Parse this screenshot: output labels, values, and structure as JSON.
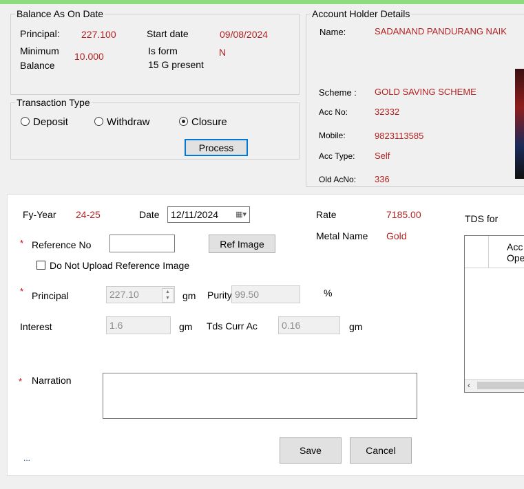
{
  "balance": {
    "legend": "Balance As On Date",
    "principal_label": "Principal:",
    "principal_value": "227.100",
    "start_date_label": "Start date",
    "start_date_value": "09/08/2024",
    "min_balance_label_1": "Minimum",
    "min_balance_label_2": "Balance",
    "min_balance_value": "10.000",
    "form15g_label_1": "Is form",
    "form15g_label_2": "15 G present",
    "form15g_value": "N"
  },
  "account_holder": {
    "legend": "Account Holder Details",
    "name_label": "Name:",
    "name_value": "SADANAND PANDURANG NAIK",
    "scheme_label": "Scheme :",
    "scheme_value": "GOLD SAVING SCHEME",
    "accno_label": "Acc No:",
    "accno_value": "32332",
    "mobile_label": "Mobile:",
    "mobile_value": "9823113585",
    "acctype_label": "Acc Type:",
    "acctype_value": "Self",
    "oldacno_label": "Old AcNo:",
    "oldacno_value": "336"
  },
  "transaction_type": {
    "legend": "Transaction Type",
    "options": [
      "Deposit",
      "Withdraw",
      "Closure"
    ],
    "selected": "Closure",
    "process_label": "Process"
  },
  "form": {
    "fy_label": "Fy-Year",
    "fy_value": "24-25",
    "date_label": "Date",
    "date_value": "12/11/2024",
    "rate_label": "Rate",
    "rate_value": "7185.00",
    "metal_label": "Metal Name",
    "metal_value": "Gold",
    "tds_label": "TDS for",
    "reference_label": "Reference No",
    "reference_value": "",
    "ref_image_label": "Ref Image",
    "no_upload_label": "Do Not Upload Reference Image",
    "principal_label": "Principal",
    "principal_value": "227.10",
    "principal_unit": "gm",
    "purity_label": "Purity",
    "purity_value": "99.50",
    "purity_unit": "%",
    "interest_label": "Interest",
    "interest_value": "1.6",
    "interest_unit": "gm",
    "tds_curr_label": "Tds Curr Ac",
    "tds_curr_value": "0.16",
    "tds_curr_unit": "gm",
    "narration_label": "Narration",
    "narration_value": "",
    "save_label": "Save",
    "cancel_label": "Cancel",
    "ellipsis": "..."
  },
  "grid": {
    "header_1": "Acc",
    "header_2": "Ope"
  }
}
